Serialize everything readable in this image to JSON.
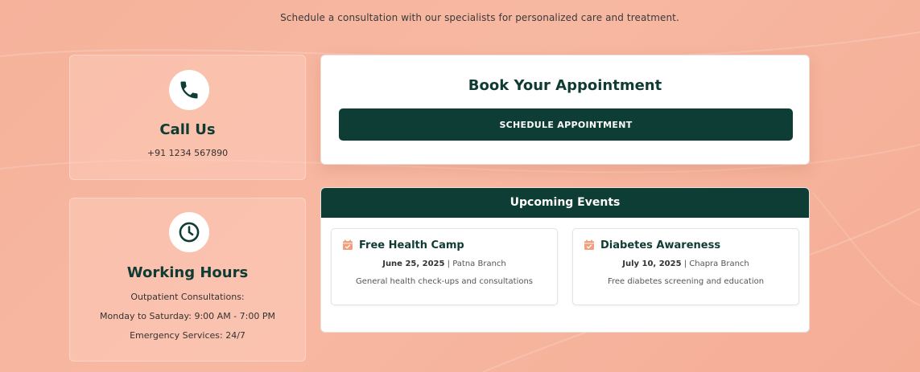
{
  "intro": {
    "text": "Schedule a consultation with our specialists for personalized care and treatment."
  },
  "call_us": {
    "icon": "phone-icon",
    "title": "Call Us",
    "phone": "+91 1234 567890"
  },
  "working_hours": {
    "icon": "clock-icon",
    "title": "Working Hours",
    "lines": [
      "Outpatient Consultations:",
      "Monday to Saturday: 9:00 AM - 7:00 PM",
      "Emergency Services: 24/7"
    ]
  },
  "appointment": {
    "title": "Book Your Appointment",
    "button_label": "SCHEDULE APPOINTMENT"
  },
  "events": {
    "header": "Upcoming Events",
    "items": [
      {
        "icon": "calendar-check-icon",
        "title": "Free Health Camp",
        "date": "June 25, 2025",
        "separator": " | ",
        "location": "Patna Branch",
        "description": "General health check-ups and consultations"
      },
      {
        "icon": "calendar-check-icon",
        "title": "Diabetes Awareness",
        "date": "July 10, 2025",
        "separator": " | ",
        "location": "Chapra Branch",
        "description": "Free diabetes screening and education"
      }
    ]
  },
  "colors": {
    "background": "#f6b29b",
    "primary": "#0d3d35",
    "accent_icon": "#f0a080",
    "card": "#ffffff"
  }
}
